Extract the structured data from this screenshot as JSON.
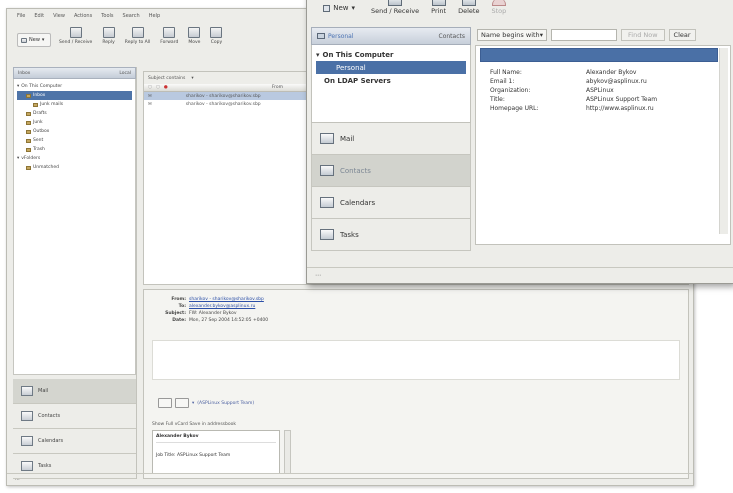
{
  "mail_window": {
    "menu": [
      "File",
      "Edit",
      "View",
      "Actions",
      "Tools",
      "Search",
      "Help"
    ],
    "toolbar": {
      "new_label": "New",
      "buttons": [
        "Send / Receive",
        "Reply",
        "Reply to All",
        "Forward",
        "Move",
        "Copy"
      ]
    },
    "sidebar": {
      "header_title": "Inbox",
      "header_extra": "Local",
      "tree": [
        {
          "label": "On This Computer",
          "level": 0,
          "expanded": true
        },
        {
          "label": "Inbox",
          "level": 1,
          "selected": true
        },
        {
          "label": "Junk mails",
          "level": 2
        },
        {
          "label": "Drafts",
          "level": 1
        },
        {
          "label": "Junk",
          "level": 1
        },
        {
          "label": "Outbox",
          "level": 1
        },
        {
          "label": "Sent",
          "level": 1
        },
        {
          "label": "Trash",
          "level": 1
        },
        {
          "label": "vFolders",
          "level": 0,
          "expanded": true
        },
        {
          "label": "Unmatched",
          "level": 1
        }
      ],
      "switcher": [
        "Mail",
        "Contacts",
        "Calendars",
        "Tasks"
      ]
    },
    "message_list": {
      "filter_label": "Subject contains",
      "column_from": "From",
      "rows": [
        {
          "from": "sharikov - sharikov@sharikov.sbp",
          "selected": true
        },
        {
          "from": "sharikov - sharikov@sharikov.sbp",
          "selected": false
        }
      ]
    },
    "preview": {
      "headers": [
        {
          "key": "From:",
          "value": "sharikov - sharikov@sharikov.sbp",
          "link": true
        },
        {
          "key": "To:",
          "value": "alexander.bykov@asplinux.ru",
          "link": true
        },
        {
          "key": "Subject:",
          "value": "FW: Alexander Bykov",
          "link": false
        },
        {
          "key": "Date:",
          "value": "Mon, 27 Sep 2004 14:52:05 +0400",
          "link": false
        }
      ],
      "attachment_text": "(ASPLinux Support Team)",
      "vcard_label": "Show Full vCard  Save in addressbook",
      "vcard_name": "Alexander Bykov",
      "vcard_jobtitle": "Job Title:  ASPLinux Support Team"
    },
    "status_text": "⋯"
  },
  "contacts_window": {
    "toolbar": {
      "new_label": "New",
      "buttons": [
        {
          "label": "Send / Receive",
          "enabled": true
        },
        {
          "label": "Print",
          "enabled": true
        },
        {
          "label": "Delete",
          "enabled": true
        },
        {
          "label": "Stop",
          "enabled": false
        }
      ]
    },
    "sidebar": {
      "header_title": "Personal",
      "header_extra": "Contacts",
      "tree": [
        {
          "label": "On This Computer",
          "expanded": true,
          "selected": false,
          "indent": false
        },
        {
          "label": "Personal",
          "expanded": false,
          "selected": true,
          "indent": false
        },
        {
          "label": "On LDAP Servers",
          "expanded": false,
          "selected": false,
          "indent": true
        }
      ],
      "switcher": [
        {
          "label": "Mail",
          "active": false
        },
        {
          "label": "Contacts",
          "active": true
        },
        {
          "label": "Calendars",
          "active": false
        },
        {
          "label": "Tasks",
          "active": false
        }
      ]
    },
    "search": {
      "criteria_label": "Name begins with",
      "find_label": "Find Now",
      "clear_label": "Clear"
    },
    "contact": {
      "fields": [
        {
          "label": "Full Name:",
          "value": "Alexander Bykov"
        },
        {
          "label": "Email 1:",
          "value": "abykov@asplinux.ru"
        },
        {
          "label": "Organization:",
          "value": "ASPLinux"
        },
        {
          "label": "Title:",
          "value": "ASPLinux Support Team"
        },
        {
          "label": "Homepage URL:",
          "value": "http://www.asplinux.ru"
        }
      ]
    },
    "status_text": "⋯"
  },
  "colors": {
    "selection": "#4a70a6",
    "window_bg": "#ededE9",
    "link": "#2b4fa8"
  }
}
